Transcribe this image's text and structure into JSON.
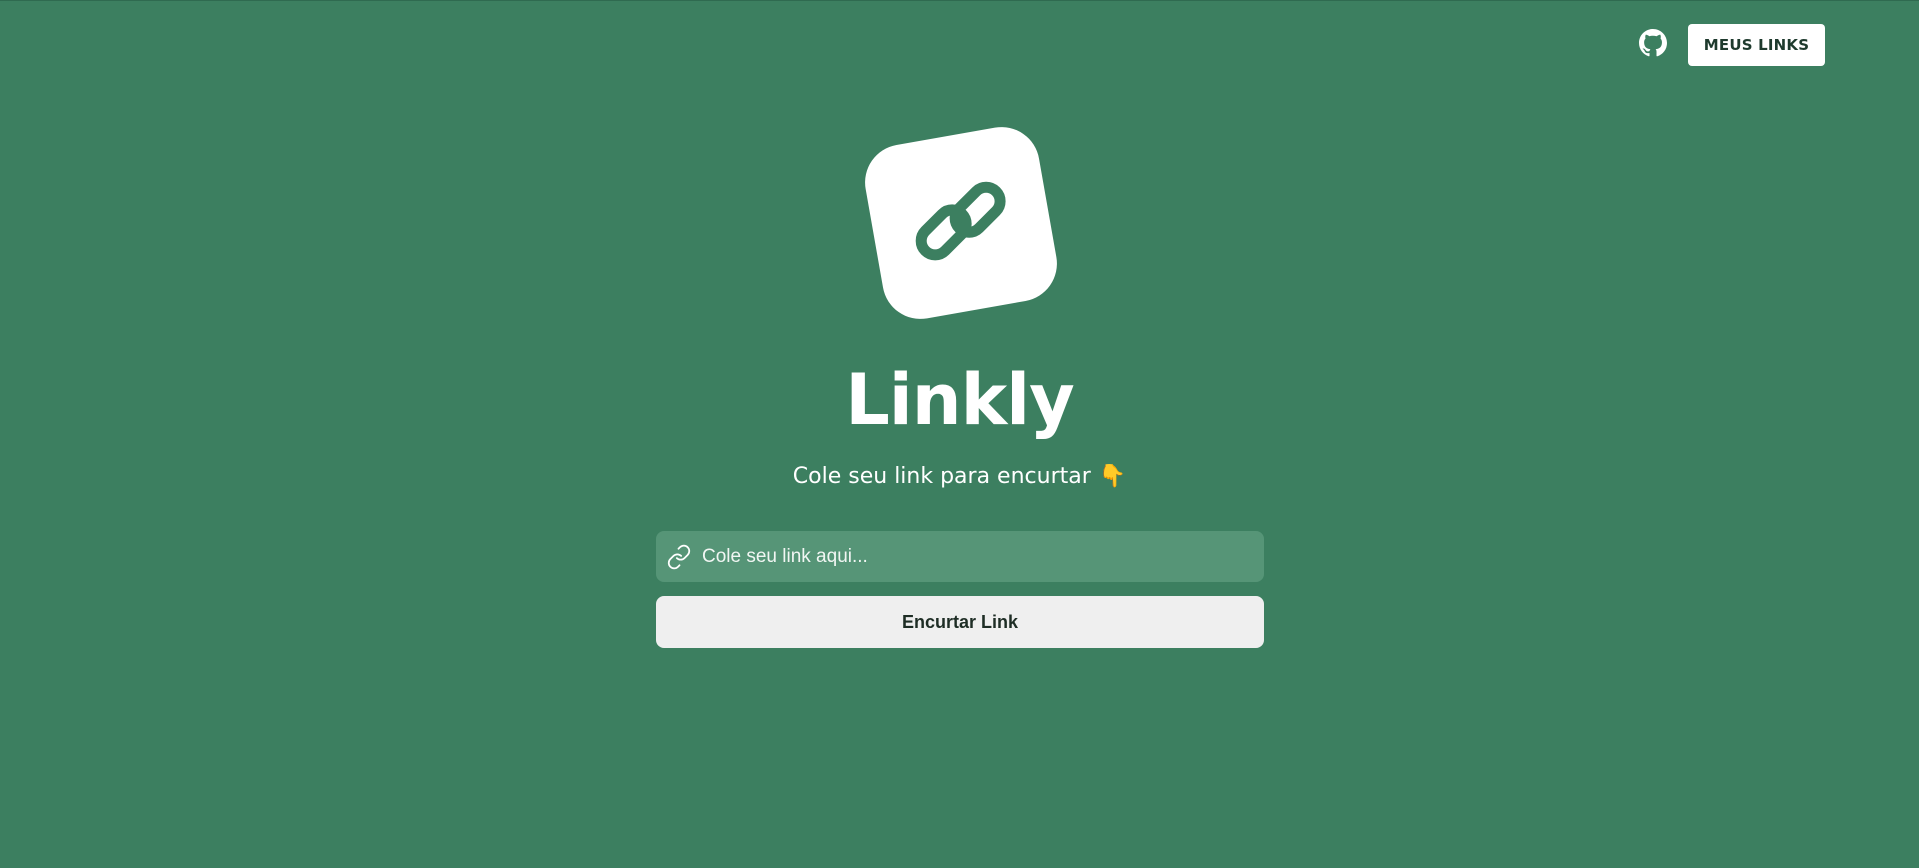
{
  "header": {
    "github_icon": "github-icon",
    "my_links_label": "MEUS LINKS"
  },
  "logo": {
    "icon": "chain-link-icon"
  },
  "hero": {
    "title": "Linkly",
    "subtitle": "Cole seu link para encurtar",
    "subtitle_emoji": "👇"
  },
  "form": {
    "input_icon": "link-icon",
    "placeholder": "Cole seu link aqui...",
    "value": "",
    "submit_label": "Encurtar Link"
  },
  "colors": {
    "background": "#3c7f60",
    "input_background": "#569577",
    "button_background": "#efefef"
  }
}
